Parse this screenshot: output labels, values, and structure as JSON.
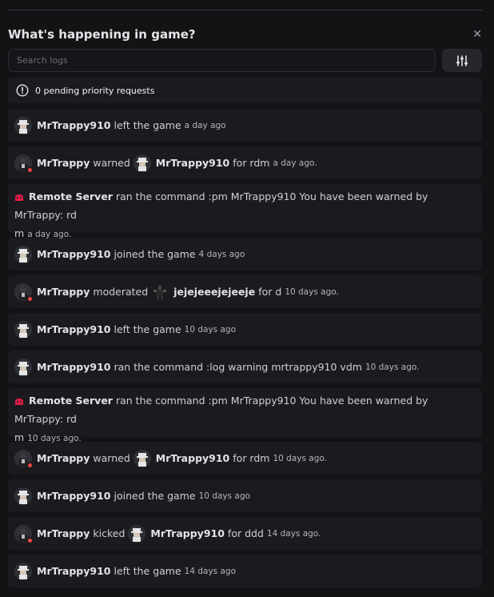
{
  "header": {
    "title": "What's happening in game?",
    "close_icon": "close-icon"
  },
  "search": {
    "placeholder": "Search logs",
    "value": ""
  },
  "filter": {
    "icon": "sliders-icon"
  },
  "pending": {
    "text": "0 pending priority requests",
    "icon": "alert-circle-icon"
  },
  "colors": {
    "status_dot": "#ef4444",
    "server_icon": "#e11d48"
  },
  "logs": [
    {
      "actor": "MrTrappy910",
      "action": "left the game",
      "time": "a day ago"
    },
    {
      "actor": "MrTrappy",
      "action": "warned",
      "target": "MrTrappy910",
      "detail": "for rdm",
      "time": "a day ago."
    },
    {
      "actor": "Remote Server",
      "action": "ran the command :pm MrTrappy910 You have been warned by MrTrappy: rd",
      "action_cont": "m",
      "time": "a day ago."
    },
    {
      "actor": "MrTrappy910",
      "action": "joined the game",
      "time": "4 days ago"
    },
    {
      "actor": "MrTrappy",
      "action": "moderated",
      "target": "jejejeeejejeeje",
      "detail": "for d",
      "time": "10 days ago."
    },
    {
      "actor": "MrTrappy910",
      "action": "left the game",
      "time": "10 days ago"
    },
    {
      "actor": "MrTrappy910",
      "action": "ran the command :log warning mrtrappy910 vdm",
      "time": "10 days ago."
    },
    {
      "actor": "Remote Server",
      "action": "ran the command :pm MrTrappy910 You have been warned by MrTrappy: rd",
      "action_cont": "m",
      "time": "10 days ago."
    },
    {
      "actor": "MrTrappy",
      "action": "warned",
      "target": "MrTrappy910",
      "detail": "for rdm",
      "time": "10 days ago."
    },
    {
      "actor": "MrTrappy910",
      "action": "joined the game",
      "time": "10 days ago"
    },
    {
      "actor": "MrTrappy",
      "action": "kicked",
      "target": "MrTrappy910",
      "detail": "for ddd",
      "time": "14 days ago."
    },
    {
      "actor": "MrTrappy910",
      "action": "left the game",
      "time": "14 days ago"
    }
  ]
}
